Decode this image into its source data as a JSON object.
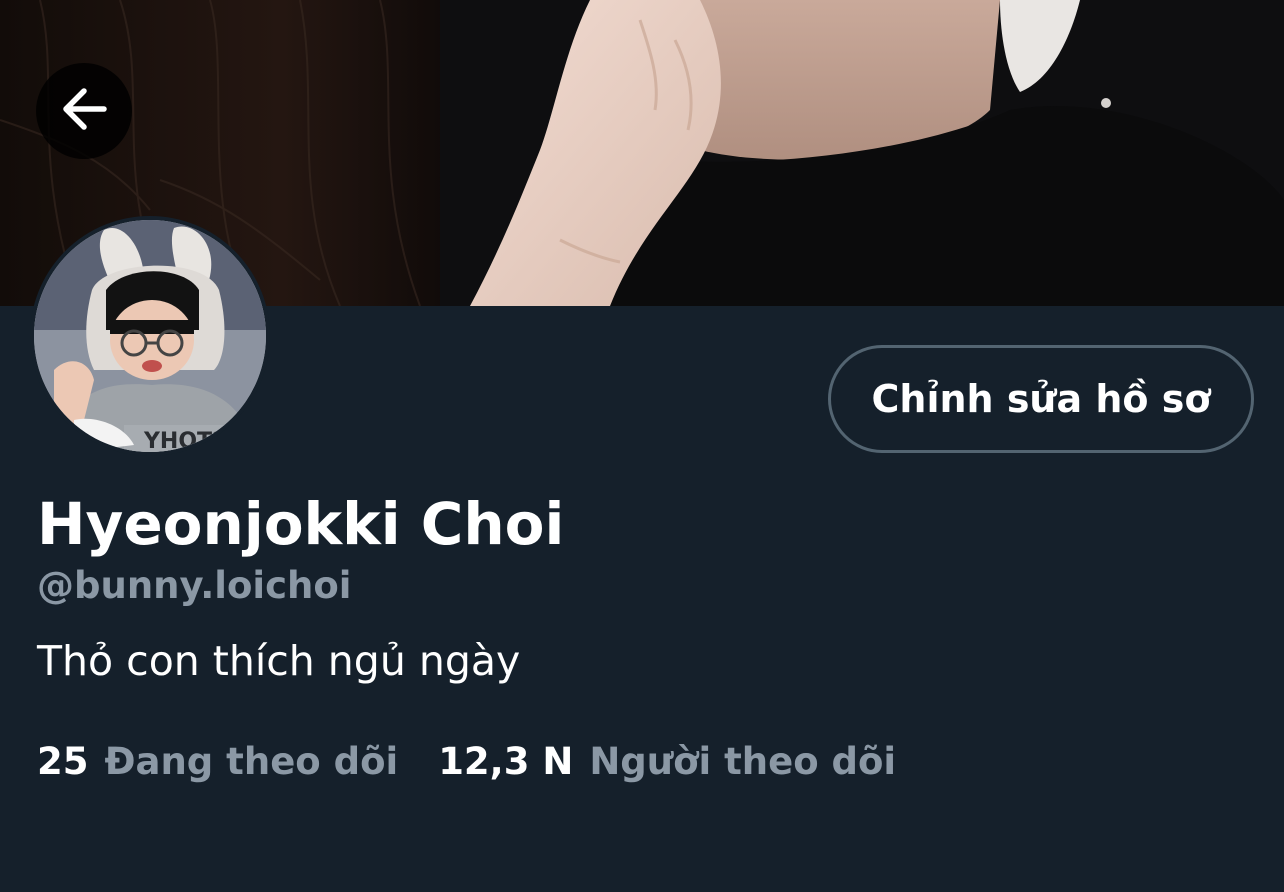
{
  "profile": {
    "edit_label": "Chỉnh sửa hồ sơ",
    "display_name": "Hyeonjokki Choi",
    "handle": "@bunny.loichoi",
    "bio": "Thỏ con thích ngủ ngày"
  },
  "stats": {
    "following_count": "25",
    "following_label": "Đang theo dõi",
    "followers_count": "12,3 N",
    "followers_label": "Người theo dõi"
  },
  "icons": {
    "back": "arrow-left-icon"
  },
  "colors": {
    "background": "#15202b",
    "primary_text": "#ffffff",
    "secondary_text": "#8b98a5",
    "button_border": "#536471"
  }
}
